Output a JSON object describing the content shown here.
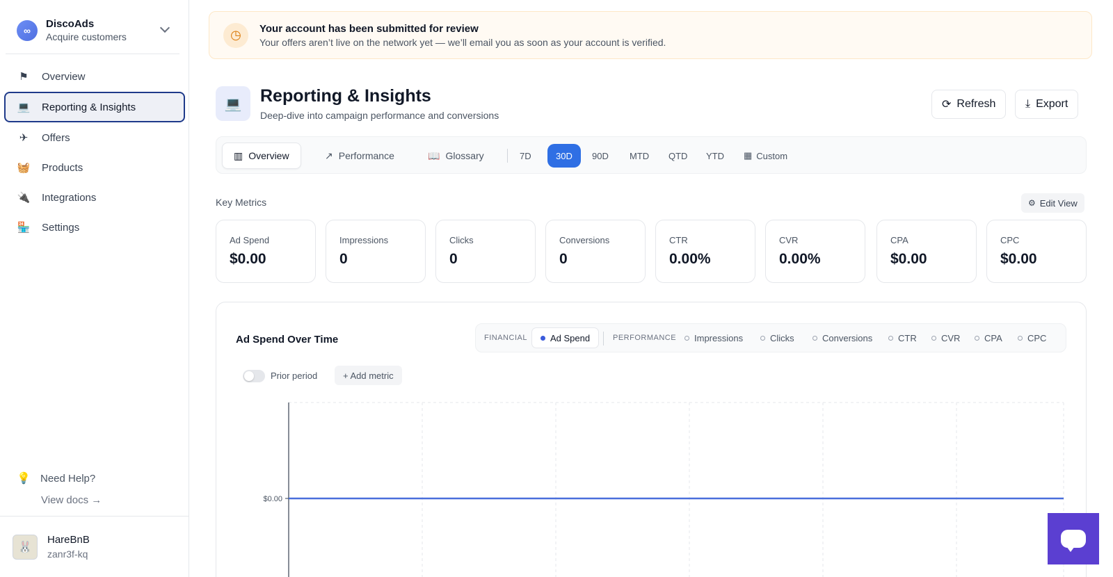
{
  "brand": {
    "name": "DiscoAds",
    "tagline": "Acquire customers"
  },
  "sidebar": {
    "items": [
      {
        "label": "Overview",
        "icon": "flag-icon"
      },
      {
        "label": "Reporting & Insights",
        "icon": "laptop-chart-icon",
        "active": true
      },
      {
        "label": "Offers",
        "icon": "plane-icon"
      },
      {
        "label": "Products",
        "icon": "gift-basket-icon"
      },
      {
        "label": "Integrations",
        "icon": "plug-icon"
      },
      {
        "label": "Settings",
        "icon": "storefront-icon"
      }
    ],
    "help": {
      "title": "Need Help?",
      "link": "View docs →"
    }
  },
  "user": {
    "name": "HareBnB",
    "id": "zanr3f-kq"
  },
  "banner": {
    "title": "Your account has been submitted for review",
    "description": "Your offers aren’t live on the network yet — we’ll email you as soon as your account is verified."
  },
  "page": {
    "title": "Reporting & Insights",
    "subtitle": "Deep-dive into campaign performance and conversions",
    "refresh_label": "Refresh",
    "export_label": "Export"
  },
  "tabs": [
    {
      "label": "Overview",
      "active": true
    },
    {
      "label": "Performance"
    },
    {
      "label": "Glossary"
    }
  ],
  "ranges": [
    "7D",
    "30D",
    "90D",
    "MTD",
    "QTD",
    "YTD"
  ],
  "selected_range": "30D",
  "custom_label": "Custom",
  "key_metrics": {
    "label": "Key Metrics",
    "edit_view": "Edit View",
    "items": [
      {
        "label": "Ad Spend",
        "value": "$0.00"
      },
      {
        "label": "Impressions",
        "value": "0"
      },
      {
        "label": "Clicks",
        "value": "0"
      },
      {
        "label": "Conversions",
        "value": "0"
      },
      {
        "label": "CTR",
        "value": "0.00%"
      },
      {
        "label": "CVR",
        "value": "0.00%"
      },
      {
        "label": "CPA",
        "value": "$0.00"
      },
      {
        "label": "CPC",
        "value": "$0.00"
      }
    ]
  },
  "chart_card": {
    "title": "Ad Spend Over Time",
    "financial_label": "FINANCIAL",
    "performance_label": "PERFORMANCE",
    "financial_metrics": [
      "Ad Spend"
    ],
    "performance_metrics": [
      "Impressions",
      "Clicks",
      "Conversions",
      "CTR",
      "CVR",
      "CPA",
      "CPC"
    ],
    "prior_period_label": "Prior period",
    "prior_period_on": false,
    "add_metric_label": "+ Add metric"
  },
  "chart_data": {
    "type": "line",
    "title": "Ad Spend Over Time",
    "series": [
      {
        "values": [
          0,
          0,
          0,
          0,
          0,
          0,
          0
        ]
      }
    ],
    "y_tick_labels": [
      "$0.00"
    ],
    "line_color": "#4a6fdc",
    "grid": true
  }
}
